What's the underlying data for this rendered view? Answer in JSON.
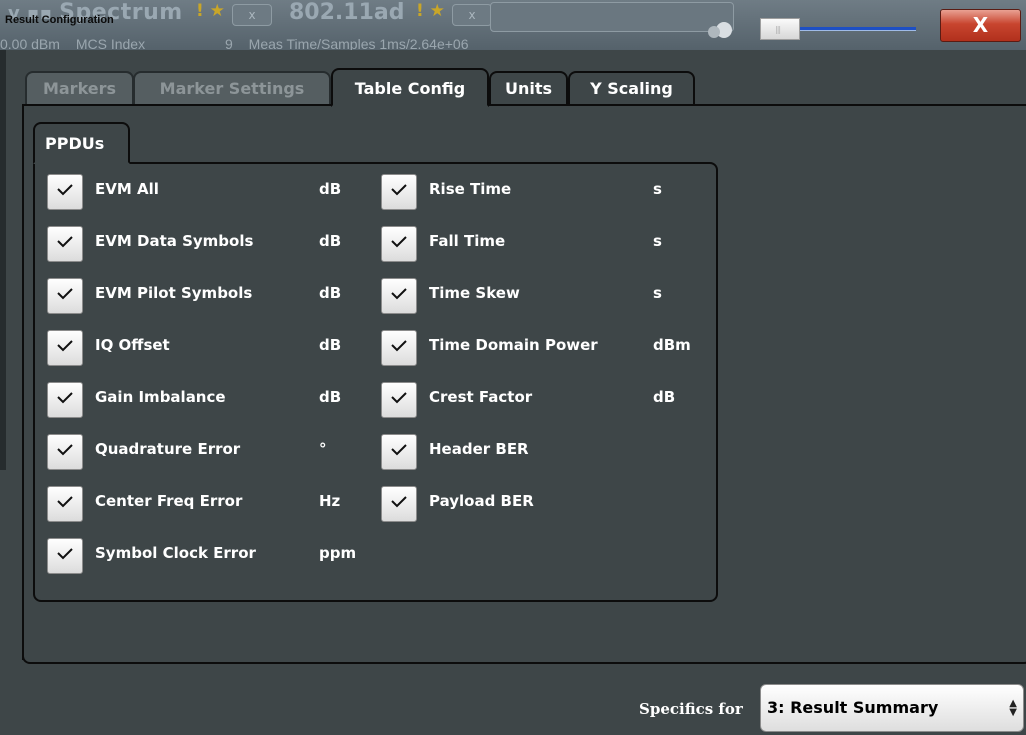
{
  "window": {
    "background_app": "Spectrum",
    "background_app2": "802.11ad",
    "dialog_title": "Result Configuration",
    "tab_close_glyph": "x",
    "status_items": [
      "0.00 dBm",
      "MCS Index",
      "9",
      "Meas Time/Samples 1ms/2.64e+06"
    ],
    "close_label": "X"
  },
  "tabs": [
    {
      "label": "Markers",
      "state": "inactive"
    },
    {
      "label": "Marker Settings",
      "state": "inactive"
    },
    {
      "label": "Table Config",
      "state": "active"
    },
    {
      "label": "Units",
      "state": "normal"
    },
    {
      "label": "Y Scaling",
      "state": "normal"
    }
  ],
  "group": {
    "title": "PPDUs",
    "left_items": [
      {
        "label": "EVM All",
        "unit": "dB",
        "checked": true
      },
      {
        "label": "EVM Data Symbols",
        "unit": "dB",
        "checked": true
      },
      {
        "label": "EVM Pilot Symbols",
        "unit": "dB",
        "checked": true
      },
      {
        "label": "IQ Offset",
        "unit": "dB",
        "checked": true
      },
      {
        "label": "Gain Imbalance",
        "unit": "dB",
        "checked": true
      },
      {
        "label": "Quadrature Error",
        "unit": "°",
        "checked": true
      },
      {
        "label": "Center Freq Error",
        "unit": "Hz",
        "checked": true
      },
      {
        "label": "Symbol Clock Error",
        "unit": "ppm",
        "checked": true
      }
    ],
    "right_items": [
      {
        "label": "Rise Time",
        "unit": "s",
        "checked": true
      },
      {
        "label": "Fall Time",
        "unit": "s",
        "checked": true
      },
      {
        "label": "Time Skew",
        "unit": "s",
        "checked": true
      },
      {
        "label": "Time Domain Power",
        "unit": "dBm",
        "checked": true
      },
      {
        "label": "Crest Factor",
        "unit": "dB",
        "checked": true
      },
      {
        "label": "Header BER",
        "unit": "",
        "checked": true
      },
      {
        "label": "Payload BER",
        "unit": "",
        "checked": true
      }
    ]
  },
  "footer": {
    "specifics_label": "Specifics for",
    "specifics_value": "3: Result Summary"
  },
  "colors": {
    "background": "#3e4648",
    "close_button": "#c8452f",
    "slider_track": "#1d4fc4"
  }
}
